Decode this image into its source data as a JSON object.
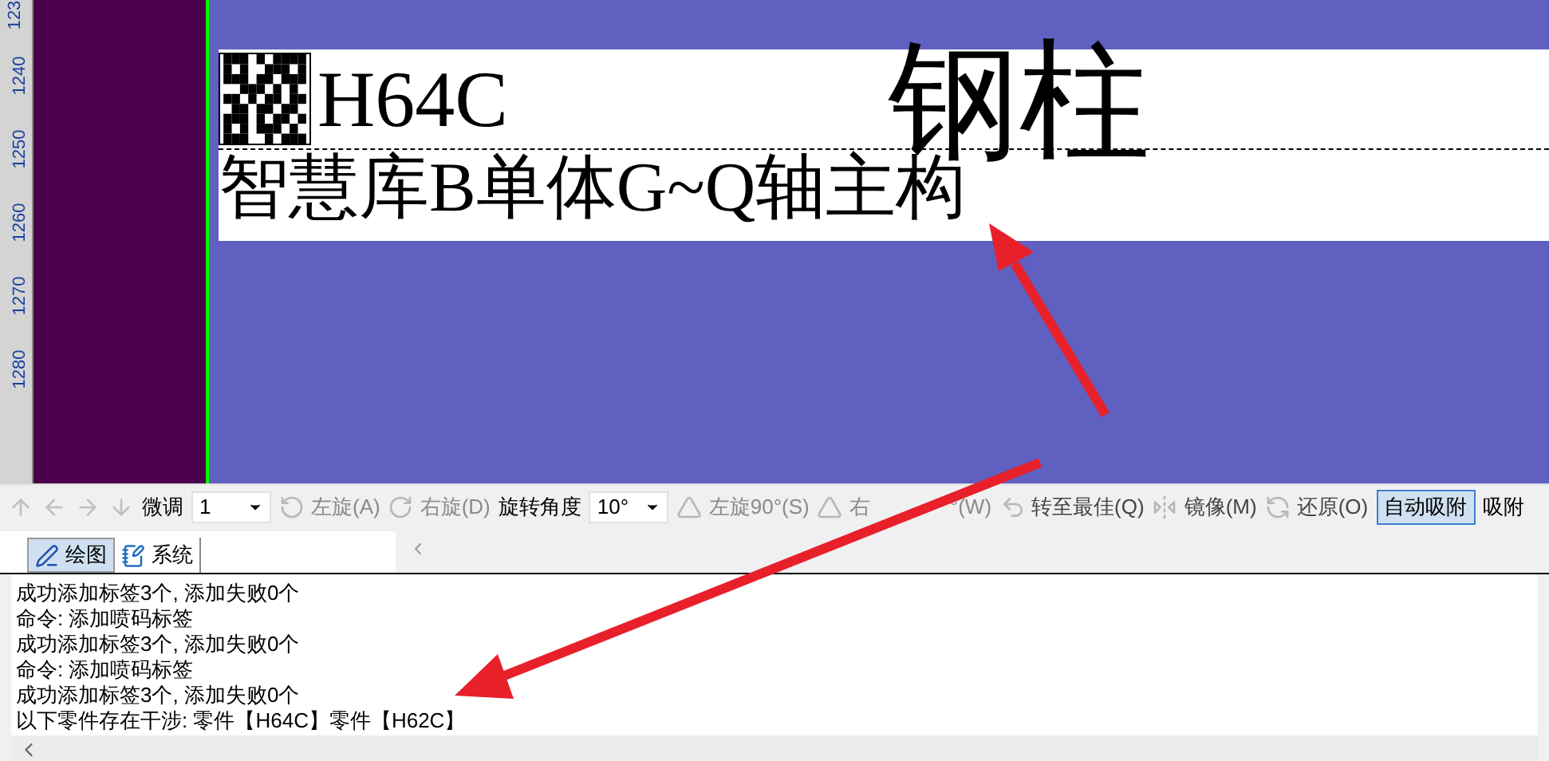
{
  "ruler": {
    "ticks": [
      "123",
      "1240",
      "1250",
      "1260",
      "1270",
      "1280"
    ]
  },
  "label": {
    "code": "H64C",
    "title": "钢柱",
    "subtitle": "智慧库B单体G~Q轴主构"
  },
  "toolbar": {
    "nudge_buttons": [
      {
        "disabled": true
      },
      {
        "disabled": true
      },
      {
        "disabled": true
      },
      {
        "disabled": true
      }
    ],
    "items": [
      {
        "kind": "label",
        "text": "微调"
      },
      {
        "kind": "select",
        "value": "1"
      },
      {
        "kind": "button",
        "text": "左旋(A)",
        "disabled": true
      },
      {
        "kind": "button",
        "text": "右旋(D)",
        "disabled": true
      },
      {
        "kind": "label",
        "text": "旋转角度"
      },
      {
        "kind": "select",
        "value": "10°"
      },
      {
        "kind": "button",
        "text": "左旋90°(S)",
        "disabled": true
      },
      {
        "kind": "button",
        "text": "右",
        "text_after": "°(W)",
        "disabled": true
      },
      {
        "kind": "button",
        "text": "转至最佳(Q)",
        "disabled": false
      },
      {
        "kind": "button",
        "text": "镜像(M)",
        "disabled": false
      },
      {
        "kind": "button",
        "text": "还原(O)",
        "disabled": false
      },
      {
        "kind": "toggle",
        "text": "自动吸附",
        "selected": true
      },
      {
        "kind": "label",
        "text": "吸附"
      }
    ]
  },
  "tabs": [
    {
      "label": "绘图",
      "selected": true
    },
    {
      "label": "系统",
      "selected": false
    }
  ],
  "log": [
    "成功添加标签3个, 添加失败0个",
    "命令: 添加喷码标签",
    "成功添加标签3个, 添加失败0个",
    "命令: 添加喷码标签",
    "成功添加标签3个, 添加失败0个",
    "以下零件存在干涉: 零件【H64C】零件【H62C】"
  ]
}
